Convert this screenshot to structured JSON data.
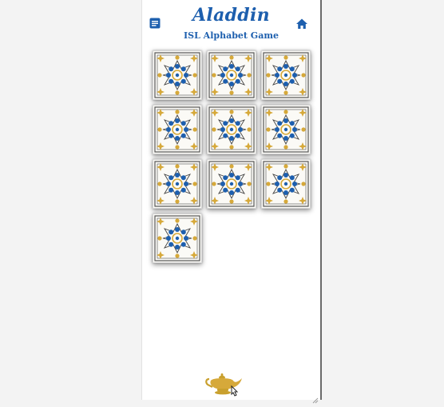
{
  "app": {
    "title": "Aladdin",
    "subtitle": "ISL Alphabet Game"
  },
  "header": {
    "menu_icon": "document-icon",
    "home_icon": "home-icon"
  },
  "colors": {
    "primary_blue": "#1d5fae",
    "gold": "#d6a93a",
    "tile_background": "#fbfaf6"
  },
  "tiles": [
    {
      "id": 1,
      "state": "face-down"
    },
    {
      "id": 2,
      "state": "face-down"
    },
    {
      "id": 3,
      "state": "face-down"
    },
    {
      "id": 4,
      "state": "face-down"
    },
    {
      "id": 5,
      "state": "face-down"
    },
    {
      "id": 6,
      "state": "face-down"
    },
    {
      "id": 7,
      "state": "face-down"
    },
    {
      "id": 8,
      "state": "face-down"
    },
    {
      "id": 9,
      "state": "face-down"
    },
    {
      "id": 10,
      "state": "face-down"
    }
  ],
  "footer": {
    "lamp_icon": "magic-lamp-icon"
  }
}
